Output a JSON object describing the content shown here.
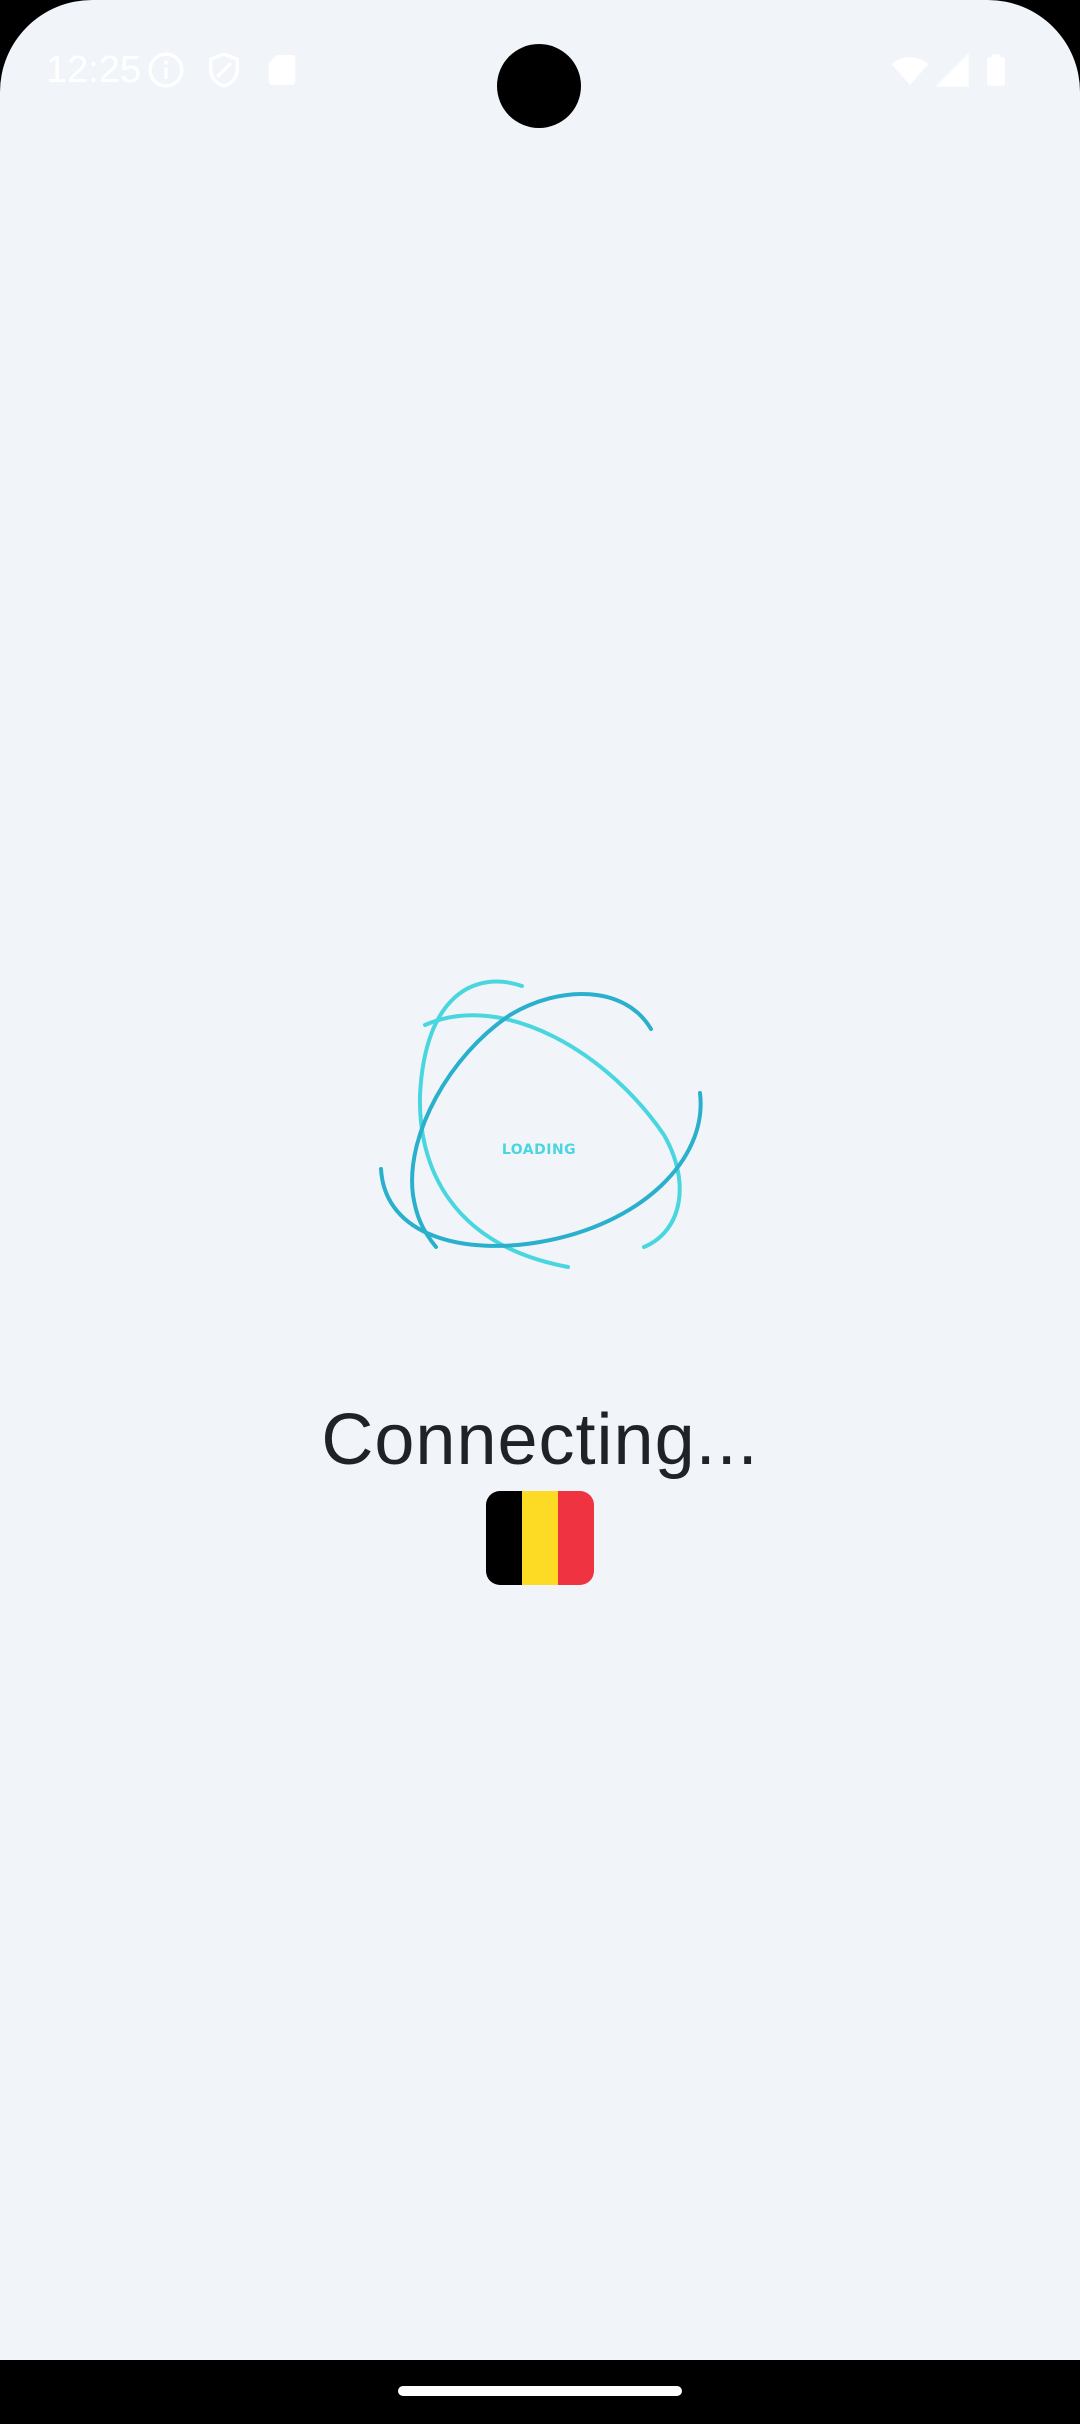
{
  "status_bar": {
    "time": "12:25",
    "left_icons": [
      "info-icon",
      "shield-icon",
      "sim-card-icon"
    ],
    "right_icons": [
      "wifi-icon",
      "cellular-signal-icon",
      "battery-icon"
    ]
  },
  "loader": {
    "label": "LOADING",
    "colors": {
      "light": "#4ad6de",
      "dark": "#2ab0cc"
    }
  },
  "connection": {
    "status_text": "Connecting...",
    "country_flag": "belgium-flag",
    "flag_colors": [
      "#000000",
      "#fdda24",
      "#ef3340"
    ]
  },
  "colors": {
    "background": "#f1f5fa",
    "text": "#1f2227"
  }
}
